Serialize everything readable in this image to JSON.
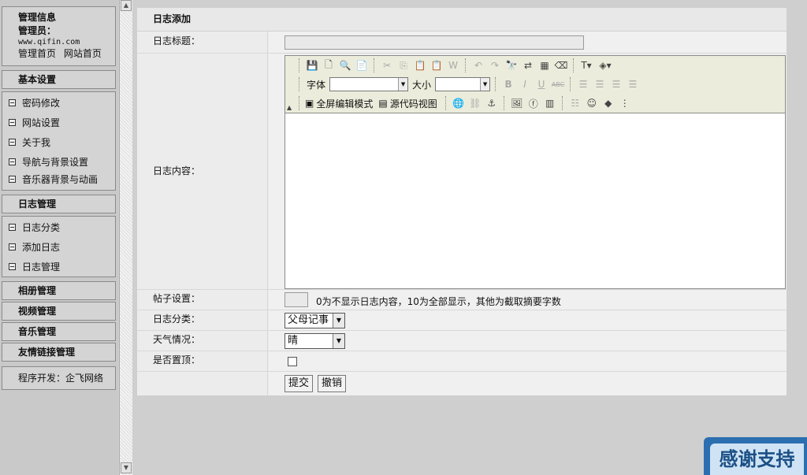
{
  "sidebar": {
    "info": {
      "title": "管理信息",
      "admin_label": "管理员：",
      "domain": "www.qifin.com",
      "links": [
        "管理首页",
        "网站首页"
      ]
    },
    "sections": [
      {
        "label": "基本设置",
        "items": [
          "密码修改",
          "网站设置",
          "关于我",
          "导航与背景设置",
          "音乐器背景与动画"
        ]
      },
      {
        "label": "日志管理",
        "items": [
          "日志分类",
          "添加日志",
          "日志管理"
        ]
      }
    ],
    "extra_sections": [
      "相册管理",
      "视频管理",
      "音乐管理",
      "友情链接管理"
    ],
    "footer": "程序开发：企飞网络"
  },
  "form": {
    "title": "日志添加",
    "fields": {
      "title_label": "日志标题：",
      "title_value": "",
      "content_label": "日志内容：",
      "post_label": "帖子设置：",
      "post_value": "",
      "post_hint": "0为不显示日志内容，10为全部显示，其他为截取摘要字数",
      "category_label": "日志分类：",
      "category_value": "父母记事",
      "weather_label": "天气情况：",
      "weather_value": "晴",
      "top_label": "是否置顶：",
      "top_checked": false
    },
    "editor": {
      "font_label": "字体",
      "size_label": "大小",
      "font_value": "",
      "size_value": "",
      "fullscreen_label": "全屏编辑模式",
      "source_label": "源代码视图"
    },
    "buttons": {
      "submit": "提交",
      "cancel": "撤销"
    }
  },
  "badge": {
    "text": "感谢支持"
  }
}
